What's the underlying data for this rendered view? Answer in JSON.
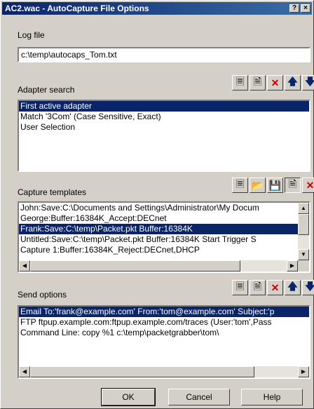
{
  "window": {
    "title": "AC2.wac - AutoCapture File Options",
    "help_glyph": "?",
    "close_glyph": "×"
  },
  "log_file": {
    "label": "Log file",
    "value": "c:\\temp\\autocaps_Tom.txt"
  },
  "adapter_search": {
    "label": "Adapter search",
    "items": [
      "First active adapter",
      "Match '3Com' (Case Sensitive, Exact)",
      "User Selection"
    ],
    "selected_index": 0
  },
  "capture_templates": {
    "label": "Capture templates",
    "items": [
      "John:Save:C:\\Documents and Settings\\Administrator\\My Docum",
      "George:Buffer:16384K_Accept:DECnet",
      "Frank:Save:C:\\temp\\Packet.pkt Buffer:16384K",
      "Untitled:Save:C:\\temp\\Packet.pkt Buffer:16384K Start Trigger S",
      "Capture 1:Buffer:16384K_Reject:DECnet,DHCP"
    ],
    "selected_index": 2
  },
  "send_options": {
    "label": "Send options",
    "items": [
      "Email To:'frank@example.com' From:'tom@example.com' Subject:'p",
      "FTP ftpup.example.com:ftpup.example.com/traces (User:'tom',Pass",
      "Command Line: copy %1 c:\\temp\\packetgrabber\\tom\\"
    ],
    "selected_index": 0
  },
  "buttons": {
    "ok": "OK",
    "cancel": "Cancel",
    "help": "Help"
  },
  "colors": {
    "selection": "#0a246a",
    "delete_red": "#cc0000",
    "arrow_blue": "#0a246a"
  }
}
